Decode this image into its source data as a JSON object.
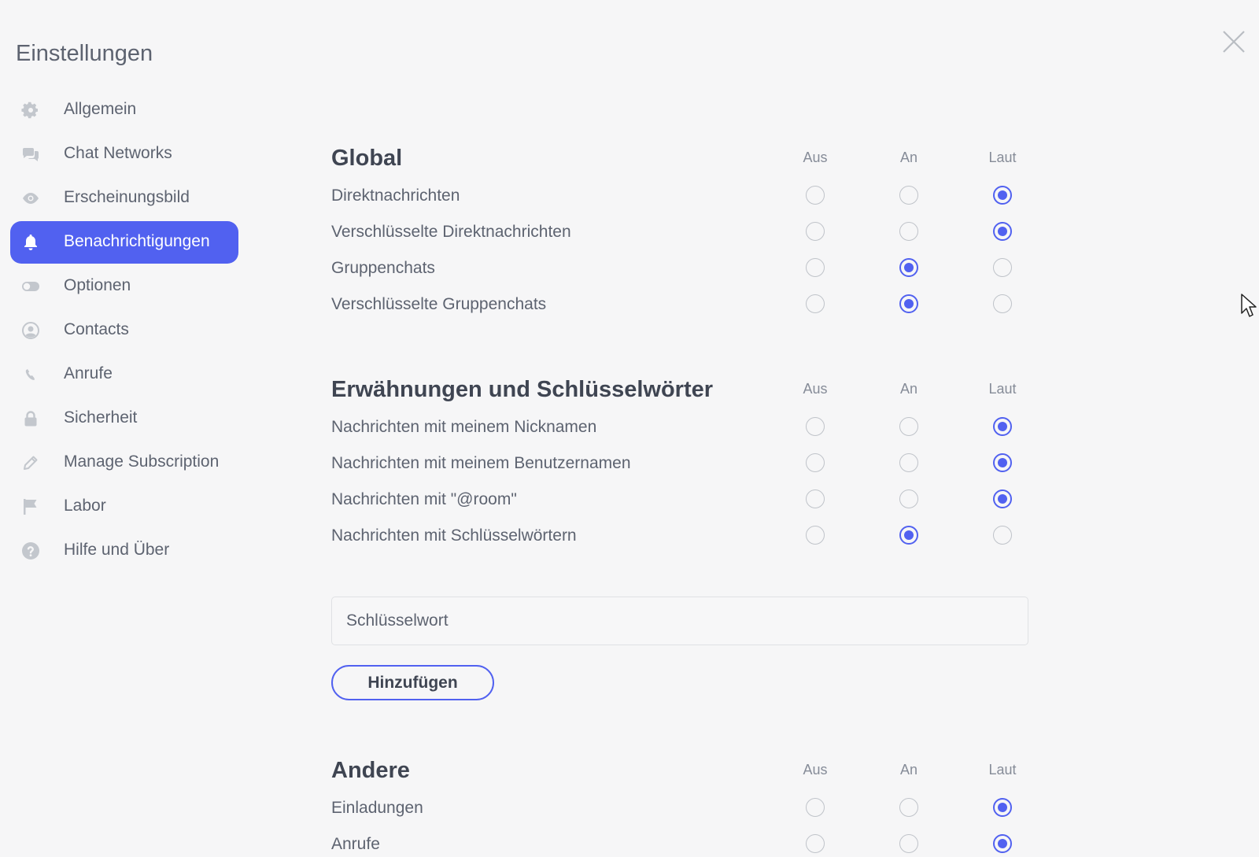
{
  "window": {
    "title": "Einstellungen",
    "close_icon": "close-icon"
  },
  "colors": {
    "accent": "#5161f0",
    "background": "#f6f6f7",
    "text": "#5d6370",
    "heading": "#3f4552"
  },
  "sidebar": {
    "items": [
      {
        "label": "Allgemein",
        "icon": "gear-icon",
        "active": false
      },
      {
        "label": "Chat Networks",
        "icon": "chat-bubbles-icon",
        "active": false
      },
      {
        "label": "Erscheinungsbild",
        "icon": "eye-icon",
        "active": false
      },
      {
        "label": "Benachrichtigungen",
        "icon": "bell-icon",
        "active": true
      },
      {
        "label": "Optionen",
        "icon": "toggle-icon",
        "active": false
      },
      {
        "label": "Contacts",
        "icon": "user-circle-icon",
        "active": false
      },
      {
        "label": "Anrufe",
        "icon": "phone-icon",
        "active": false
      },
      {
        "label": "Sicherheit",
        "icon": "lock-icon",
        "active": false
      },
      {
        "label": "Manage Subscription",
        "icon": "pencil-icon",
        "active": false
      },
      {
        "label": "Labor",
        "icon": "flag-icon",
        "active": false
      },
      {
        "label": "Hilfe und Über",
        "icon": "help-circle-icon",
        "active": false
      }
    ]
  },
  "columns": [
    "Aus",
    "An",
    "Laut"
  ],
  "sections": [
    {
      "title": "Global",
      "rows": [
        {
          "label": "Direktnachrichten",
          "selected": "Laut"
        },
        {
          "label": "Verschlüsselte Direktnachrichten",
          "selected": "Laut"
        },
        {
          "label": "Gruppenchats",
          "selected": "An"
        },
        {
          "label": "Verschlüsselte Gruppenchats",
          "selected": "An"
        }
      ]
    },
    {
      "title": "Erwähnungen und Schlüsselwörter",
      "rows": [
        {
          "label": "Nachrichten mit meinem Nicknamen",
          "selected": "Laut"
        },
        {
          "label": "Nachrichten mit meinem Benutzernamen",
          "selected": "Laut"
        },
        {
          "label": "Nachrichten mit \"@room\"",
          "selected": "Laut"
        },
        {
          "label": "Nachrichten mit Schlüsselwörtern",
          "selected": "An"
        }
      ]
    },
    {
      "title": "Andere",
      "rows": [
        {
          "label": "Einladungen",
          "selected": "Laut"
        },
        {
          "label": "Anrufe",
          "selected": "Laut"
        }
      ]
    }
  ],
  "keyword": {
    "placeholder": "Schlüsselwort",
    "value": "",
    "add_label": "Hinzufügen"
  }
}
